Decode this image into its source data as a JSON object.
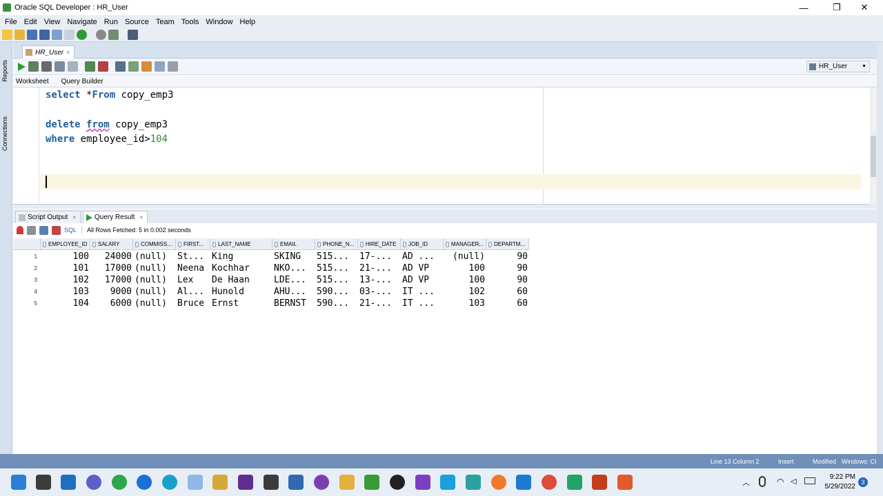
{
  "window": {
    "title": "Oracle SQL Developer : HR_User",
    "minimize": "—",
    "maximize": "❐",
    "close": "✕"
  },
  "menu": [
    "File",
    "Edit",
    "View",
    "Navigate",
    "Run",
    "Source",
    "Team",
    "Tools",
    "Window",
    "Help"
  ],
  "side_tabs": {
    "reports": "Reports",
    "connections": "Connections"
  },
  "doc_tab": {
    "label": "HR_User",
    "close": "×"
  },
  "connection": {
    "label": "HR_User"
  },
  "worksheet_tabs": {
    "worksheet": "Worksheet",
    "query_builder": "Query Builder"
  },
  "editor": {
    "line1": {
      "kw1": "select",
      "rest": " *",
      "kw2": "From",
      "rest2": " copy_emp3"
    },
    "line3": {
      "kw1": "delete",
      "mid": " ",
      "kw2": "from",
      "rest": " copy_emp3"
    },
    "line4": {
      "kw1": "where",
      "rest": " employee_id>",
      "num": "104"
    }
  },
  "result_tabs": {
    "script_output": "Script Output",
    "query_result": "Query Result",
    "close": "×"
  },
  "result_toolbar": {
    "sql": "SQL",
    "status": "All Rows Fetched: 5 in 0.002 seconds"
  },
  "grid": {
    "columns": [
      "EMPLOYEE_ID",
      "SALARY",
      "COMMISS...",
      "FIRST...",
      "LAST_NAME",
      "EMAIL",
      "PHONE_N...",
      "HIRE_DATE",
      "JOB_ID",
      "MANAGER...",
      "DEPARTM..."
    ],
    "rows": [
      [
        "1",
        "100",
        "24000",
        "(null)",
        "St...",
        "King",
        "SKING",
        "515...",
        "17-...",
        "AD ...",
        "(null)",
        "90"
      ],
      [
        "2",
        "101",
        "17000",
        "(null)",
        "Neena",
        "Kochhar",
        "NKO...",
        "515...",
        "21-...",
        "AD VP",
        "100",
        "90"
      ],
      [
        "3",
        "102",
        "17000",
        "(null)",
        "Lex",
        "De Haan",
        "LDE...",
        "515...",
        "13-...",
        "AD VP",
        "100",
        "90"
      ],
      [
        "4",
        "103",
        "9000",
        "(null)",
        "Al...",
        "Hunold",
        "AHU...",
        "590...",
        "03-...",
        "IT ...",
        "102",
        "60"
      ],
      [
        "5",
        "104",
        "6000",
        "(null)",
        "Bruce",
        "Ernst",
        "BERNST",
        "590...",
        "21-...",
        "IT ...",
        "103",
        "60"
      ]
    ]
  },
  "status_bar": {
    "position": "Line 13 Column 2",
    "mode": "Insert",
    "modified": "Modified",
    "os": "Windows: CI"
  },
  "taskbar": {
    "time": "9:22 PM",
    "date": "5/29/2022",
    "notifications": "3"
  },
  "colors": {
    "keyword": "#1f5e9e",
    "number": "#2d8a2d",
    "status_bar": "#6f8fb8",
    "current_line": "#fbf6e3"
  }
}
